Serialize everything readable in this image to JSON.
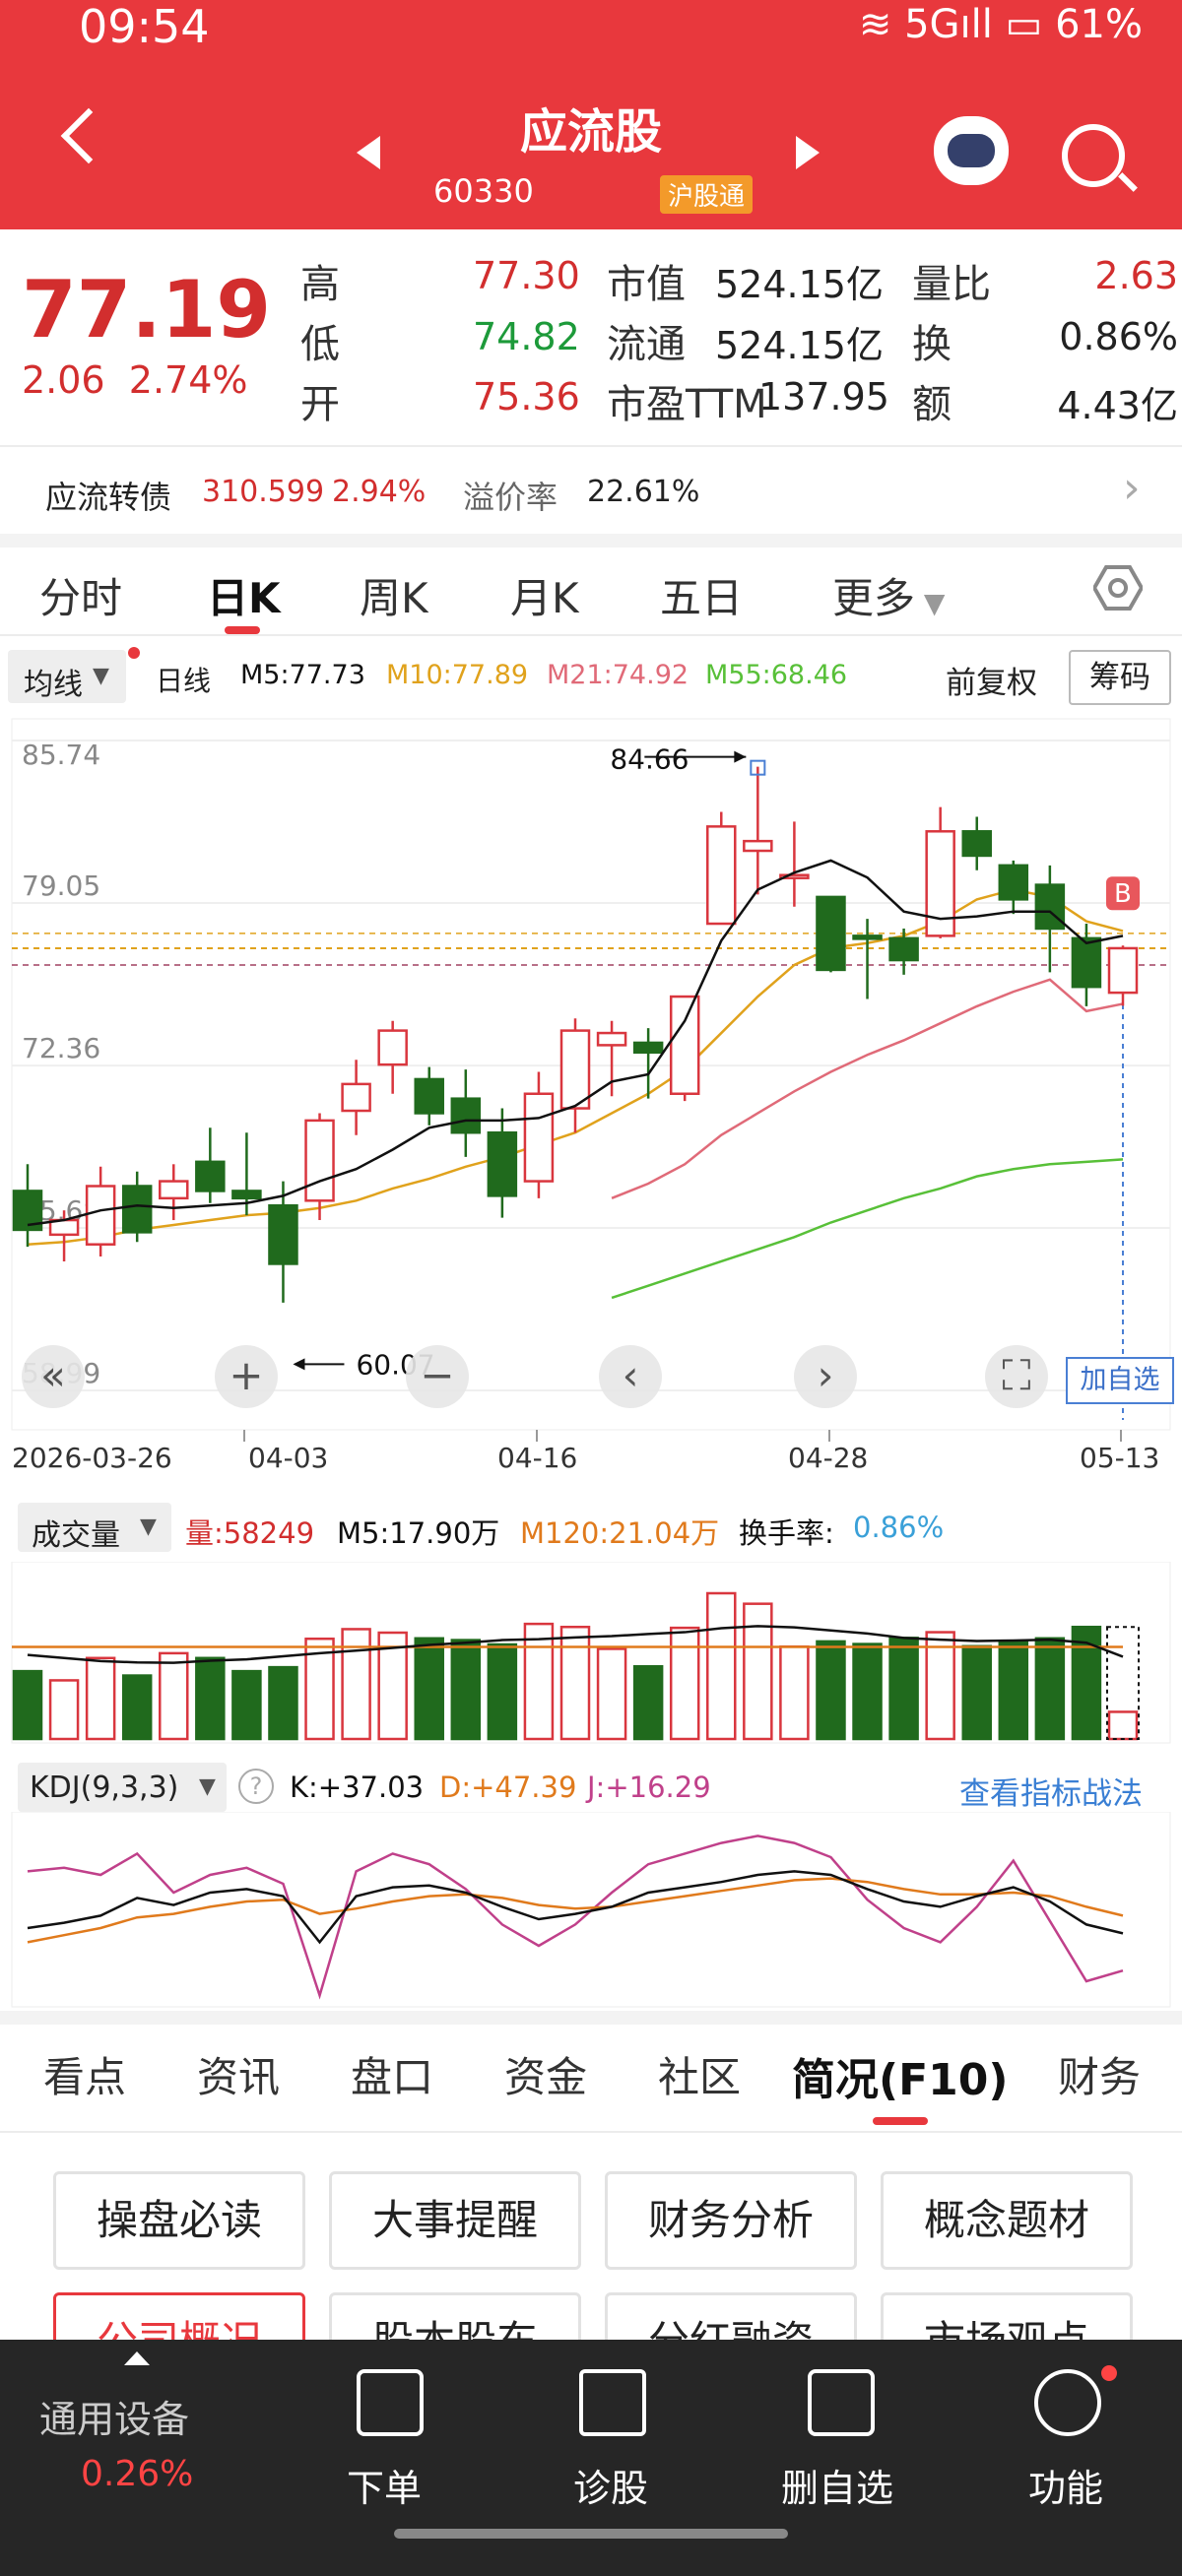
{
  "status_bar": {
    "time": "09:54",
    "battery": "61%",
    "network": "5G"
  },
  "header": {
    "name": "应流股",
    "code": "60330",
    "badge": "沪股通"
  },
  "quote": {
    "price": "77.19",
    "change": "2.06",
    "change_pct": "2.74%",
    "fields": [
      {
        "label": "高",
        "value": "77.30",
        "color": "red"
      },
      {
        "label": "低",
        "value": "74.82",
        "color": "green"
      },
      {
        "label": "开",
        "value": "75.36",
        "color": "red"
      },
      {
        "label": "市值",
        "value": "524.15亿"
      },
      {
        "label": "流通",
        "value": "524.15亿"
      },
      {
        "label": "市盈TTM",
        "value": "137.95"
      },
      {
        "label": "量比",
        "value": "2.63",
        "color": "red"
      },
      {
        "label": "换",
        "value": "0.86%"
      },
      {
        "label": "额",
        "value": "4.43亿"
      }
    ]
  },
  "bond": {
    "label": "应流转债",
    "price": "310.599",
    "pct": "2.94%",
    "premium_label": "溢价率",
    "premium": "22.61%"
  },
  "period_tabs": [
    "分时",
    "日K",
    "周K",
    "月K",
    "五日",
    "更多"
  ],
  "active_period": "日K",
  "ma_bar": {
    "indicator": "均线",
    "period": "日线",
    "ma5": "M5:77.73",
    "ma10": "M10:77.89",
    "ma21": "M21:74.92",
    "ma55": "M55:68.46",
    "adjust": "前复权",
    "chip": "筹码"
  },
  "kline": {
    "y_ticks": [
      "85.74",
      "79.05",
      "72.36",
      "65.68",
      "58.99"
    ],
    "x_ticks": [
      "2026-03-26",
      "04-03",
      "04-16",
      "04-28",
      "05-13"
    ],
    "high_marker": "84.66",
    "low_marker": "60.07",
    "b_marker": "B",
    "add_fav": "加自选",
    "colors": {
      "up": "#d9363e",
      "down": "#206a1d",
      "ma5": "#111111",
      "ma10": "#e0a21c",
      "ma21": "#e06a78",
      "ma55": "#58c038"
    }
  },
  "chart_data": {
    "type": "candlestick",
    "ylim": [
      58.99,
      85.74
    ],
    "candles": [
      {
        "o": 67.2,
        "h": 68.3,
        "l": 64.9,
        "c": 65.6
      },
      {
        "o": 65.4,
        "h": 66.4,
        "l": 64.3,
        "c": 66.0
      },
      {
        "o": 65.0,
        "h": 68.2,
        "l": 64.5,
        "c": 67.4
      },
      {
        "o": 67.4,
        "h": 68.0,
        "l": 65.1,
        "c": 65.5
      },
      {
        "o": 66.9,
        "h": 68.3,
        "l": 66.0,
        "c": 67.6
      },
      {
        "o": 68.4,
        "h": 69.8,
        "l": 66.7,
        "c": 67.2
      },
      {
        "o": 67.2,
        "h": 69.6,
        "l": 66.2,
        "c": 66.9
      },
      {
        "o": 66.6,
        "h": 67.6,
        "l": 62.6,
        "c": 64.2
      },
      {
        "o": 66.8,
        "h": 70.4,
        "l": 66.0,
        "c": 70.1
      },
      {
        "o": 70.5,
        "h": 72.6,
        "l": 69.5,
        "c": 71.6
      },
      {
        "o": 72.4,
        "h": 74.2,
        "l": 71.2,
        "c": 73.8
      },
      {
        "o": 71.8,
        "h": 72.3,
        "l": 69.9,
        "c": 70.4
      },
      {
        "o": 71.0,
        "h": 72.2,
        "l": 68.6,
        "c": 69.6
      },
      {
        "o": 69.6,
        "h": 70.6,
        "l": 66.1,
        "c": 67.0
      },
      {
        "o": 67.6,
        "h": 72.1,
        "l": 66.9,
        "c": 71.2
      },
      {
        "o": 70.6,
        "h": 74.3,
        "l": 69.6,
        "c": 73.8
      },
      {
        "o": 73.2,
        "h": 74.2,
        "l": 71.1,
        "c": 73.7
      },
      {
        "o": 73.3,
        "h": 73.9,
        "l": 71.0,
        "c": 72.9
      },
      {
        "o": 71.2,
        "h": 75.2,
        "l": 70.9,
        "c": 75.2
      },
      {
        "o": 78.2,
        "h": 82.8,
        "l": 78.2,
        "c": 82.2
      },
      {
        "o": 81.2,
        "h": 84.66,
        "l": 79.4,
        "c": 81.6
      },
      {
        "o": 80.2,
        "h": 82.4,
        "l": 78.9,
        "c": 80.2
      },
      {
        "o": 79.3,
        "h": 79.3,
        "l": 76.2,
        "c": 76.3
      },
      {
        "o": 77.7,
        "h": 78.4,
        "l": 75.1,
        "c": 77.6
      },
      {
        "o": 77.6,
        "h": 78.0,
        "l": 76.1,
        "c": 76.7
      },
      {
        "o": 77.7,
        "h": 83.0,
        "l": 77.6,
        "c": 82.0
      },
      {
        "o": 82.0,
        "h": 82.6,
        "l": 80.4,
        "c": 81.0
      },
      {
        "o": 80.6,
        "h": 80.8,
        "l": 78.6,
        "c": 79.2
      },
      {
        "o": 79.8,
        "h": 80.6,
        "l": 76.2,
        "c": 78.0
      },
      {
        "o": 77.6,
        "h": 78.2,
        "l": 74.8,
        "c": 75.6
      },
      {
        "o": 75.36,
        "h": 77.3,
        "l": 74.82,
        "c": 77.19
      }
    ],
    "ma5": [
      65.8,
      66.0,
      66.4,
      66.6,
      66.5,
      66.6,
      66.7,
      67.0,
      67.6,
      68.1,
      68.9,
      69.8,
      70.1,
      70.1,
      70.2,
      70.7,
      71.7,
      72.0,
      74.2,
      77.5,
      79.6,
      80.3,
      80.8,
      80.1,
      78.7,
      78.4,
      78.5,
      78.7,
      78.7,
      77.4,
      77.7
    ],
    "ma10": [
      65.0,
      65.1,
      65.3,
      65.6,
      65.8,
      66.0,
      66.2,
      66.3,
      66.5,
      66.8,
      67.3,
      67.7,
      68.2,
      68.6,
      69.1,
      69.6,
      70.4,
      71.2,
      72.2,
      73.7,
      75.2,
      76.5,
      77.2,
      77.4,
      77.7,
      78.3,
      79.2,
      79.6,
      79.3,
      78.3,
      77.9
    ],
    "ma21": [
      null,
      null,
      null,
      null,
      null,
      null,
      null,
      null,
      null,
      null,
      null,
      null,
      null,
      null,
      null,
      null,
      66.9,
      67.5,
      68.3,
      69.5,
      70.4,
      71.3,
      72.1,
      72.8,
      73.4,
      74.1,
      74.8,
      75.4,
      75.9,
      74.6,
      74.9
    ],
    "ma55": [
      null,
      null,
      null,
      null,
      null,
      null,
      null,
      null,
      null,
      null,
      null,
      null,
      null,
      null,
      null,
      null,
      62.8,
      63.3,
      63.8,
      64.3,
      64.8,
      65.3,
      65.9,
      66.4,
      66.9,
      67.3,
      67.8,
      68.1,
      68.3,
      68.4,
      68.5
    ]
  },
  "volume": {
    "indicator": "成交量",
    "vol": "量:58249",
    "m5": "M5:17.90万",
    "m120": "M120:21.04万",
    "turnover_label": "换手率:",
    "turnover": "0.86%",
    "bars": [
      15.5,
      13.4,
      18.5,
      14.5,
      19.6,
      18.5,
      15.5,
      16.4,
      22.9,
      25.1,
      24.3,
      23.0,
      22.6,
      21.6,
      26.3,
      25.6,
      20.6,
      16.6,
      25.4,
      33.3,
      30.9,
      21.1,
      22.3,
      21.7,
      23.1,
      24.4,
      21.2,
      22.2,
      23.0,
      25.6,
      6.2
    ],
    "m5_line": [
      19.2,
      18.5,
      17.8,
      17.5,
      17.4,
      17.9,
      18.2,
      18.9,
      19.6,
      20.2,
      20.8,
      21.5,
      22.0,
      22.6,
      22.8,
      23.2,
      23.5,
      24.0,
      24.4,
      25.3,
      25.8,
      25.5,
      24.8,
      24.1,
      23.1,
      22.7,
      22.4,
      22.5,
      22.7,
      22.0,
      18.8
    ],
    "m120_line": 21.04
  },
  "kdj": {
    "indicator": "KDJ(9,3,3)",
    "k": "K:+37.03",
    "d": "D:+47.39",
    "j": "J:+16.29",
    "link": "查看指标战法",
    "k_series": [
      40,
      43,
      47,
      57,
      53,
      60,
      62,
      58,
      32,
      58,
      63,
      64,
      60,
      52,
      45,
      48,
      52,
      60,
      63,
      66,
      70,
      72,
      70,
      62,
      55,
      52,
      58,
      63,
      55,
      42,
      37
    ],
    "d_series": [
      32,
      36,
      40,
      46,
      48,
      52,
      55,
      56,
      48,
      51,
      55,
      58,
      59,
      57,
      53,
      51,
      52,
      55,
      58,
      61,
      64,
      67,
      68,
      66,
      62,
      59,
      59,
      60,
      58,
      52,
      47
    ],
    "j_series": [
      72,
      74,
      70,
      82,
      60,
      70,
      74,
      65,
      2,
      72,
      82,
      76,
      62,
      42,
      30,
      42,
      60,
      76,
      82,
      88,
      92,
      88,
      80,
      56,
      40,
      32,
      52,
      78,
      44,
      10,
      16
    ]
  },
  "bottom_tabs": [
    "看点",
    "资讯",
    "盘口",
    "资金",
    "社区",
    "简况(F10)",
    "财务"
  ],
  "active_bottom_tab": "简况(F10)",
  "f10_buttons": [
    "操盘必读",
    "大事提醒",
    "财务分析",
    "概念题材"
  ],
  "f10_buttons_row2": [
    "公司概况",
    "股本股东",
    "分红融资",
    "市场观点"
  ],
  "bottom_nav": {
    "sector": "通用设备",
    "sector_pct": "0.26%",
    "items": [
      "下单",
      "诊股",
      "删自选",
      "功能"
    ]
  }
}
